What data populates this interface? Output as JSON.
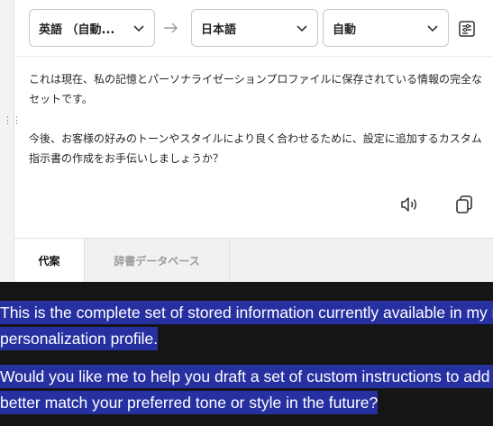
{
  "translator": {
    "source_language": "英語 （自動...",
    "target_language": "日本語",
    "mode": "自動",
    "output_paragraphs": [
      "これは現在、私の記憶とパーソナライゼーションプロファイルに保存されている情報の完全なセットです。",
      "今後、お客様の好みのトーンやスタイルにより良く合わせるために、設定に追加するカスタム指示書の作成をお手伝いしましょうか？"
    ],
    "tabs": [
      {
        "label": "代案"
      },
      {
        "label": "辞書データベース"
      }
    ]
  },
  "page_text": {
    "para1_line1": "This is the complete set of stored information currently available in my mem",
    "para1_line2": "personalization profile.",
    "para2_line1": "Would you like me to help you draft a set of custom instructions to add to yo",
    "para2_line2": "better match your preferred tone or style in the future?"
  },
  "colors": {
    "selection_highlight": "#2630a0",
    "page_background": "#151515"
  }
}
